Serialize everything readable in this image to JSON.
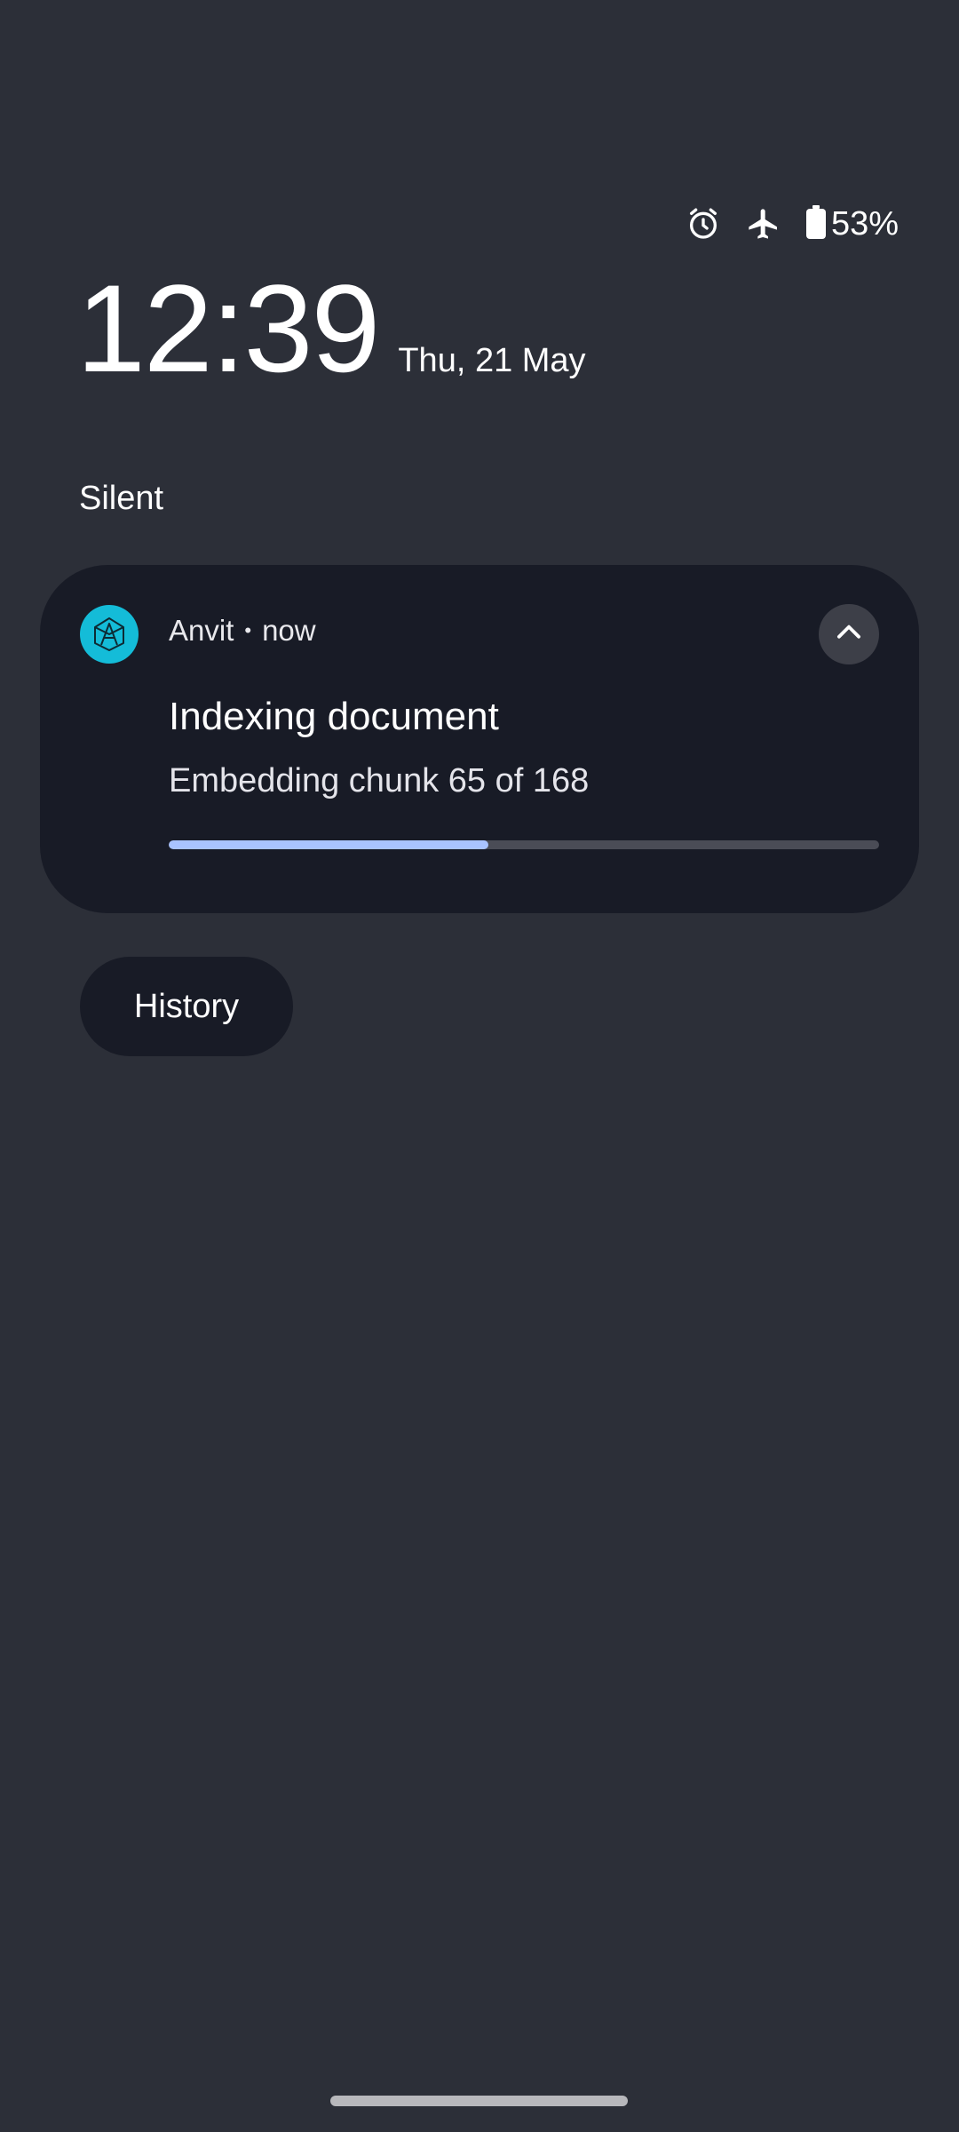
{
  "status_bar": {
    "icons": [
      "alarm-icon",
      "airplane-mode-icon",
      "battery-icon"
    ],
    "battery_percent": "53%"
  },
  "lockscreen": {
    "time": "12:39",
    "date": "Thu, 21 May"
  },
  "section": {
    "label": "Silent"
  },
  "notification": {
    "app_name": "Anvit",
    "separator": "•",
    "timestamp": "now",
    "title": "Indexing document",
    "text": "Embedding chunk 65 of 168",
    "progress": {
      "current": 65,
      "total": 168,
      "fraction": 0.45
    },
    "icon": "anvit-app-icon",
    "expand_icon": "chevron-up-icon",
    "colors": {
      "app_icon_bg": "#14bcd8",
      "progress_fill": "#a9c3ff",
      "progress_track": "#4a4c56"
    }
  },
  "history_button": {
    "label": "History"
  },
  "colors": {
    "background": "#2c2f38",
    "card": "#181b26"
  }
}
